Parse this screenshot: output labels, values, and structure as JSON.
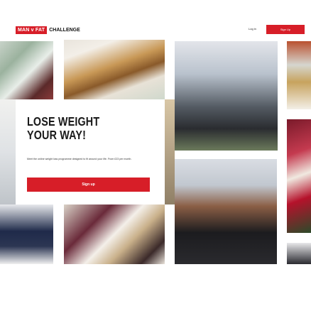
{
  "header": {
    "logo_mark": "MAN v FAT",
    "logo_word": "CHALLENGE",
    "login_label": "Log in",
    "signup_label": "Sign Up"
  },
  "hero": {
    "headline_line1": "LOSE WEIGHT",
    "headline_line2": "YOUR WAY!",
    "description": "Meet the online weight loss programme designed to fit around your life. From £23 per month.",
    "signup_label": "Sign up"
  },
  "colors": {
    "brand_red": "#d71e28",
    "text": "#1a1a1a",
    "background": "#ffffff"
  }
}
